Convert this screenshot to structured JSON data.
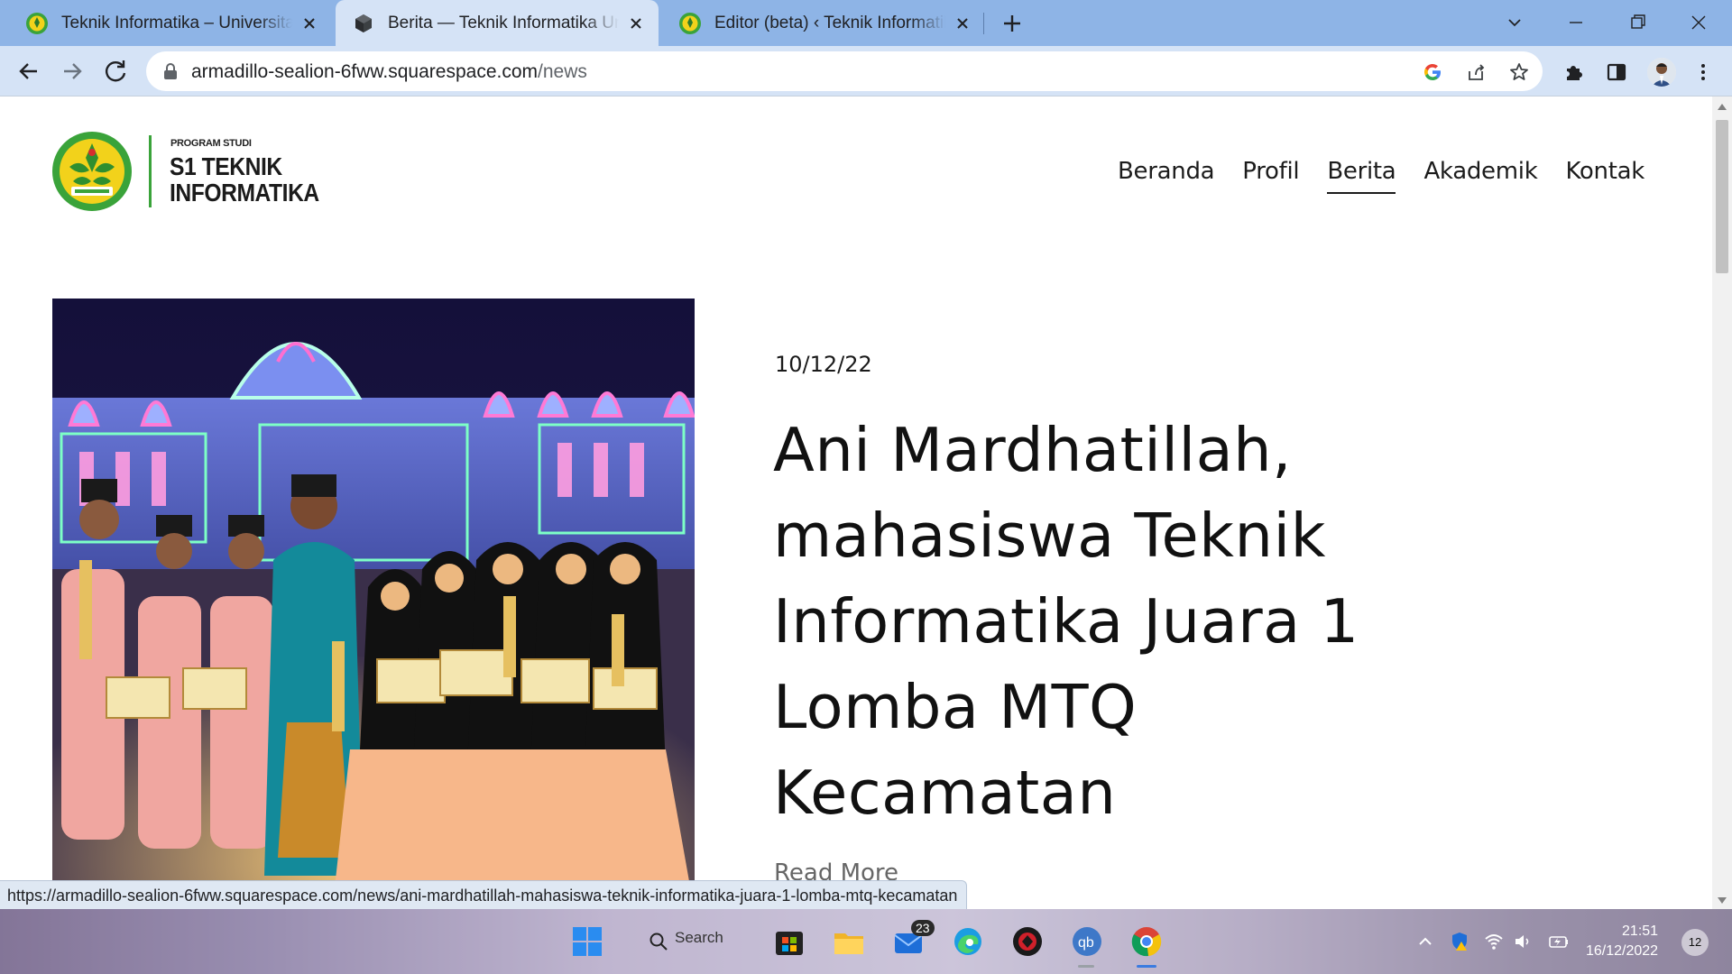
{
  "browser": {
    "tabs": [
      {
        "title": "Teknik Informatika – Universitas R",
        "icon": "university-emblem-icon",
        "active": false
      },
      {
        "title": "Berita — Teknik Informatika Unive",
        "icon": "squarespace-cube-icon",
        "active": true
      },
      {
        "title": "Editor (beta) ‹ Teknik Informatika",
        "icon": "university-emblem-icon",
        "active": false
      }
    ],
    "address": {
      "host": "armadillo-sealion-6fww.squarespace.com",
      "path": "/news"
    },
    "status_url": "https://armadillo-sealion-6fww.squarespace.com/news/ani-mardhatillah-mahasiswa-teknik-informatika-juara-1-lomba-mtq-kecamatan"
  },
  "site": {
    "logo": {
      "small": "PROGRAM STUDI",
      "line1": "S1 TEKNIK",
      "line2": "INFORMATIKA"
    },
    "nav": [
      "Beranda",
      "Profil",
      "Berita",
      "Akademik",
      "Kontak"
    ],
    "current_nav": "Berita"
  },
  "post": {
    "date": "10/12/22",
    "title": "Ani Mardhatillah, mahasiswa Teknik Informatika Juara 1 Lomba MTQ Kecamatan",
    "read_more": "Read More"
  },
  "taskbar": {
    "search_label": "Search",
    "mail_badge": "23",
    "time": "21:51",
    "date": "16/12/2022",
    "notifications": "12"
  },
  "colors": {
    "tabstrip": "#8eb4e6",
    "toolbar": "#d5e3f6",
    "logo_green": "#3aa33a",
    "emblem_yellow": "#f2d21b"
  }
}
